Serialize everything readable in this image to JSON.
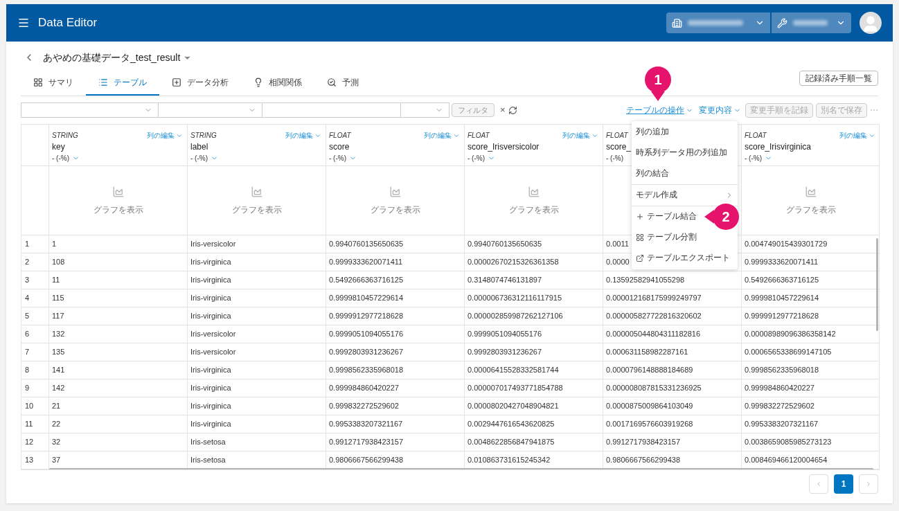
{
  "app": {
    "title": "Data Editor"
  },
  "breadcrumb": {
    "title": "あやめの基礎データ_test_result"
  },
  "tabs": [
    {
      "label": "サマリ",
      "selected": false
    },
    {
      "label": "テーブル",
      "selected": true
    },
    {
      "label": "データ分析",
      "selected": false
    },
    {
      "label": "相関関係",
      "selected": false
    },
    {
      "label": "予測",
      "selected": false
    }
  ],
  "records_button": "記録済み手順一覧",
  "filter": {
    "button": "フィルタ",
    "clear": "×"
  },
  "actions": [
    {
      "label": "テーブルの操作",
      "kind": "menu",
      "expanded": true
    },
    {
      "label": "変更内容",
      "kind": "menu",
      "expanded": false
    },
    {
      "label": "変更手順を記録",
      "kind": "button",
      "disabled": true
    },
    {
      "label": "別名で保存",
      "kind": "button",
      "disabled": true
    }
  ],
  "more": "⋯",
  "menu": [
    {
      "label": "列の追加",
      "kind": "plain",
      "divider_before": false
    },
    {
      "label": "時系列データ用の列追加",
      "kind": "plain",
      "divider_before": false
    },
    {
      "label": "列の結合",
      "kind": "plain",
      "divider_before": false
    },
    {
      "label": "モデル作成",
      "kind": "submenu",
      "divider_before": true
    },
    {
      "label": "テーブル結合",
      "kind": "add",
      "divider_before": true
    },
    {
      "label": "テーブル分割",
      "kind": "split",
      "divider_before": false
    },
    {
      "label": "テーブルエクスポート",
      "kind": "export",
      "divider_before": false
    }
  ],
  "callouts": [
    {
      "label": "1"
    },
    {
      "label": "2"
    }
  ],
  "table": {
    "columns": [
      {
        "type": "STRING",
        "name": "key",
        "stats": "- (-%)",
        "edit": "列の編集",
        "graph": "グラフを表示"
      },
      {
        "type": "STRING",
        "name": "label",
        "stats": "- (-%)",
        "edit": "列の編集",
        "graph": "グラフを表示"
      },
      {
        "type": "FLOAT",
        "name": "score",
        "stats": "- (-%)",
        "edit": "列の編集",
        "graph": "グラフを表示"
      },
      {
        "type": "FLOAT",
        "name": "score_Irisversicolor",
        "stats": "- (-%)",
        "edit": "列の編集",
        "graph": "グラフを表示"
      },
      {
        "type": "FLOAT",
        "name": "score_",
        "stats": "- (-%)"
      },
      {
        "type": "FLOAT",
        "name": "score_Irisvirginica",
        "stats": "- (-%)",
        "edit": "列の編集",
        "graph": "グラフを表示"
      }
    ],
    "rows": [
      {
        "index": "1",
        "cells": [
          "1",
          "Iris-versicolor",
          "0.9940760135650635",
          "0.9940760135650635",
          "0.0011",
          "0.004749015439301729"
        ]
      },
      {
        "index": "2",
        "cells": [
          "108",
          "Iris-virginica",
          "0.9999333620071411",
          "0.00002670215326361358",
          "0.0000",
          "0.9999333620071411"
        ]
      },
      {
        "index": "3",
        "cells": [
          "11",
          "Iris-virginica",
          "0.5492666363716125",
          "0.3148074746131897",
          "0.13592582941055298",
          "0.5492666363716125"
        ]
      },
      {
        "index": "4",
        "cells": [
          "115",
          "Iris-virginica",
          "0.9999810457229614",
          "0.000006736312116117915",
          "0.000012168175999249797",
          "0.9999810457229614"
        ]
      },
      {
        "index": "5",
        "cells": [
          "117",
          "Iris-virginica",
          "0.9999912977218628",
          "0.000002859987262127106",
          "0.000005827722816320602",
          "0.9999912977218628"
        ]
      },
      {
        "index": "6",
        "cells": [
          "132",
          "Iris-versicolor",
          "0.9999051094055176",
          "0.9999051094055176",
          "0.000005044804311182816",
          "0.00008989096386358142"
        ]
      },
      {
        "index": "7",
        "cells": [
          "135",
          "Iris-versicolor",
          "0.9992803931236267",
          "0.9992803931236267",
          "0.000631158982287161",
          "0.0006565338699147105"
        ]
      },
      {
        "index": "8",
        "cells": [
          "141",
          "Iris-virginica",
          "0.9998562335968018",
          "0.00006415528332581744",
          "0.0000796148888184689",
          "0.9998562335968018"
        ]
      },
      {
        "index": "9",
        "cells": [
          "142",
          "Iris-virginica",
          "0.999984860420227",
          "0.000007017493771854788",
          "0.000008087815331236925",
          "0.999984860420227"
        ]
      },
      {
        "index": "10",
        "cells": [
          "21",
          "Iris-virginica",
          "0.999832272529602",
          "0.00008020427048904821",
          "0.0000875009864103049",
          "0.999832272529602"
        ]
      },
      {
        "index": "11",
        "cells": [
          "22",
          "Iris-virginica",
          "0.9953383207321167",
          "0.0029447616543620825",
          "0.0017169576603919268",
          "0.9953383207321167"
        ]
      },
      {
        "index": "12",
        "cells": [
          "32",
          "Iris-setosa",
          "0.9912717938423157",
          "0.0048622856847941875",
          "0.9912717938423157",
          "0.0038659085985273123"
        ]
      },
      {
        "index": "13",
        "cells": [
          "37",
          "Iris-setosa",
          "0.9806667566299438",
          "0.010863731615245342",
          "0.9806667566299438",
          "0.008469466120004654"
        ]
      }
    ]
  },
  "pagination": {
    "pages": [
      {
        "label": "1",
        "selected": true
      }
    ]
  }
}
